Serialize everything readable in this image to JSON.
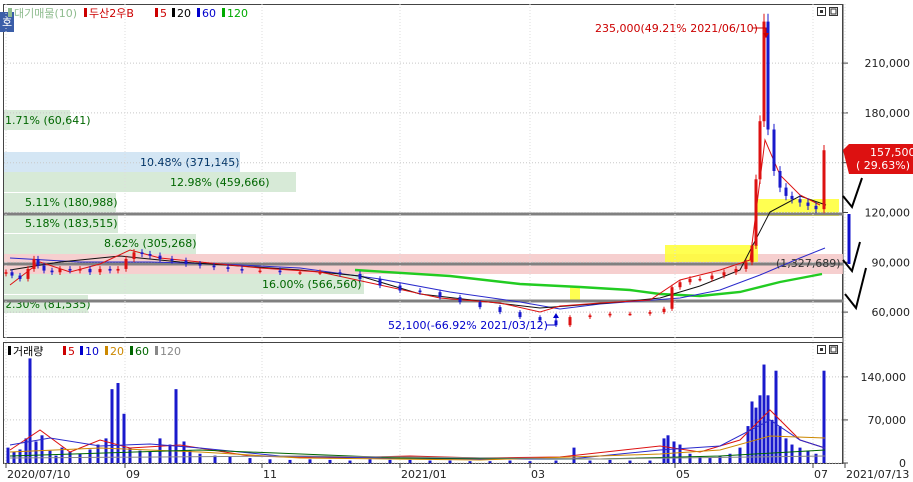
{
  "app": {
    "badge": "호",
    "price_panel_legend": [
      {
        "text": "대기매물(10)",
        "color": "#8fbc8f"
      },
      {
        "text": "두산2우B",
        "color": "#cc0000"
      },
      {
        "text": "5",
        "color": "#cc0000"
      },
      {
        "text": "20",
        "color": "#000000"
      },
      {
        "text": "60",
        "color": "#0000cc"
      },
      {
        "text": "120",
        "color": "#00aa00"
      }
    ],
    "volume_panel_legend": [
      {
        "text": "거래량",
        "color": "#000000"
      },
      {
        "text": "5",
        "color": "#cc0000"
      },
      {
        "text": "10",
        "color": "#0000cc"
      },
      {
        "text": "20",
        "color": "#cc8800"
      },
      {
        "text": "60",
        "color": "#006600"
      },
      {
        "text": "120",
        "color": "#888888"
      }
    ]
  },
  "chart_data": [
    {
      "type": "candlestick",
      "title": "두산2우B",
      "y_ticks": [
        60000,
        90000,
        120000,
        150000,
        180000,
        210000
      ],
      "y_tick_labels": [
        "60,000",
        "90,000",
        "120,000",
        "",
        "180,000",
        "210,000"
      ],
      "ylim": [
        45000,
        245000
      ],
      "x_tick_labels": [
        "2020/07/10",
        "09",
        "11",
        "2021/01",
        "03",
        "05",
        "07",
        "2021/07/13"
      ],
      "current_price": {
        "value": "157,500",
        "change": "( 29.63%)"
      },
      "annotations": {
        "high": "235,000(49.21% 2021/06/10)",
        "low": "52,100(-66.92% 2021/03/12)",
        "mid": "(1,327,689)"
      },
      "volume_profile": [
        {
          "label": "1.71% (60,641)"
        },
        {
          "label": "10.48% (371,145)"
        },
        {
          "label": "12.98% (459,666)"
        },
        {
          "label": "5.11% (180,988)"
        },
        {
          "label": "5.18% (183,515)"
        },
        {
          "label": "8.62% (305,268)"
        },
        {
          "label": "16.00% (566,560)"
        },
        {
          "label": "2.30% (81,535)"
        }
      ],
      "moving_averages": [
        "5",
        "20",
        "60",
        "120"
      ],
      "support_lines": [
        117000,
        85000,
        60000
      ]
    },
    {
      "type": "bar",
      "title": "거래량",
      "y_ticks": [
        0,
        70000,
        140000
      ],
      "y_tick_labels": [
        "0",
        "70,000",
        "140,000"
      ],
      "ylim": [
        0,
        195000
      ]
    }
  ]
}
